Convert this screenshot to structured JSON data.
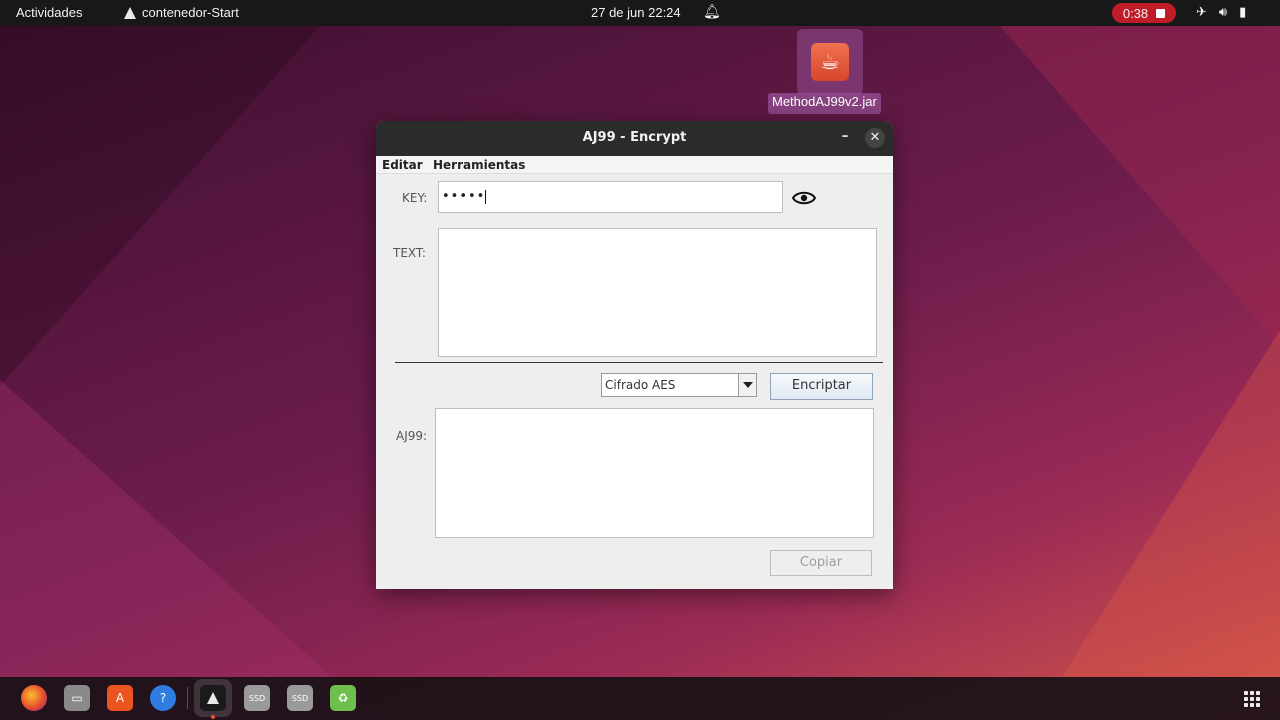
{
  "topbar": {
    "activities": "Actividades",
    "app_name": "contenedor-Start",
    "clock": "27 de jun  22:24",
    "recording_time": "0:38"
  },
  "desktop": {
    "file_icon_label": "MethodAJ99v2.jar"
  },
  "window": {
    "title": "AJ99 - Encrypt",
    "menu": [
      "Editar",
      "Herramientas"
    ],
    "key_label": "KEY:",
    "key_value": "•••••",
    "text_label": "TEXT:",
    "cipher_select": "Cifrado AES",
    "encrypt_button": "Encriptar",
    "output_label": "AJ99:",
    "copy_button": "Copiar"
  },
  "dock": {
    "items": [
      "firefox-icon",
      "files-icon",
      "software-icon",
      "help-icon",
      "app-launcher-icon",
      "disk-icon",
      "disk-icon",
      "trash-icon",
      "show-apps-icon"
    ]
  },
  "colors": {
    "topbar_bg": "#181818",
    "record_badge": "#c01c28",
    "window_bg": "#eeeeee",
    "ubuntu_orange": "#e95420"
  }
}
